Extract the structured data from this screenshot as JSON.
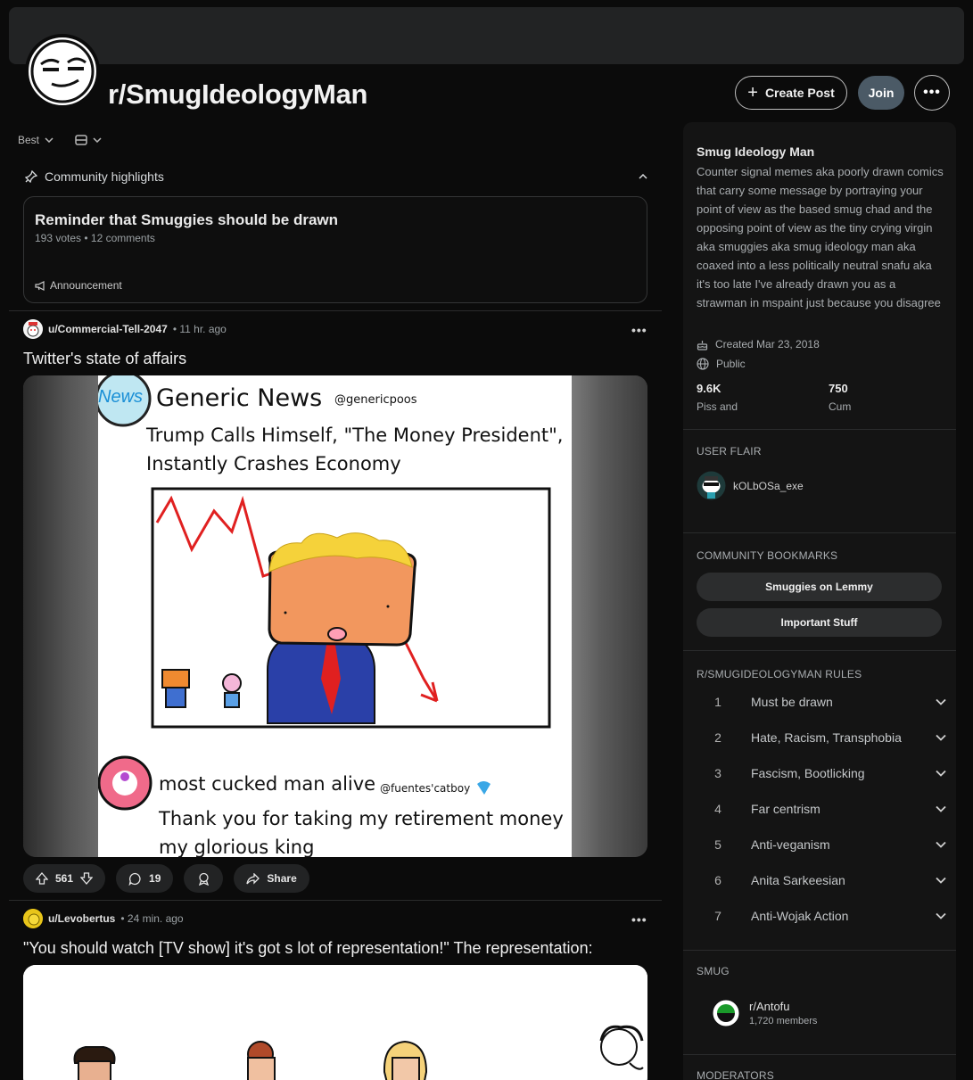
{
  "header": {
    "subreddit": "r/SmugIdeologyMan",
    "create_post": "Create Post",
    "join": "Join",
    "more": "•••"
  },
  "sort": {
    "label": "Best"
  },
  "highlights": {
    "label": "Community highlights",
    "card": {
      "title": "Reminder that Smuggies should be drawn",
      "meta": "193 votes • 12 comments",
      "tag": "Announcement"
    }
  },
  "posts": [
    {
      "author": "u/Commercial-Tell-2047",
      "time": "• 11 hr. ago",
      "title": "Twitter's state of affairs",
      "image": {
        "news_name": "Generic News",
        "news_handle": "@genericpoos",
        "headline_1": "Trump Calls Himself, \"The Money President\",",
        "headline_2": "Instantly Crashes Economy",
        "reply_name": "most cucked man alive",
        "reply_handle": "@fuentes'catboy",
        "reply_1": "Thank you for taking my retirement money",
        "reply_2": "my glorious king",
        "badge": "News"
      },
      "upvotes": "561",
      "comments": "19",
      "share": "Share"
    },
    {
      "author": "u/Levobertus",
      "time": "• 24 min. ago",
      "title": "\"You should watch [TV show] it's got s lot of representation!\" The representation:"
    }
  ],
  "sidebar": {
    "name": "Smug Ideology Man",
    "description": "Counter signal memes aka poorly drawn comics that carry some message by portraying your point of view as the based smug chad and the opposing point of view as the tiny crying virgin aka smuggies aka smug ideology man aka coaxed into a less politically neutral snafu aka it's too late I've already drawn you as a strawman in mspaint just because you disagree",
    "created": "Created Mar 23, 2018",
    "visibility": "Public",
    "stats": [
      {
        "value": "9.6K",
        "label": "Piss and"
      },
      {
        "value": "750",
        "label": "Cum"
      }
    ],
    "user_flair_heading": "USER FLAIR",
    "user_flair": "kOLbOSa_exe",
    "bookmarks_heading": "COMMUNITY BOOKMARKS",
    "bookmarks": [
      "Smuggies on Lemmy",
      "Important Stuff"
    ],
    "rules_heading": "R/SMUGIDEOLOGYMAN RULES",
    "rules": [
      {
        "num": "1",
        "text": "Must be drawn"
      },
      {
        "num": "2",
        "text": "Hate, Racism, Transphobia"
      },
      {
        "num": "3",
        "text": "Fascism, Bootlicking"
      },
      {
        "num": "4",
        "text": "Far centrism"
      },
      {
        "num": "5",
        "text": "Anti-veganism"
      },
      {
        "num": "6",
        "text": "Anita Sarkeesian"
      },
      {
        "num": "7",
        "text": "Anti-Wojak Action"
      }
    ],
    "smug_heading": "SMUG",
    "community": {
      "name": "r/Antofu",
      "members": "1,720 members"
    },
    "moderators_heading": "MODERATORS"
  }
}
